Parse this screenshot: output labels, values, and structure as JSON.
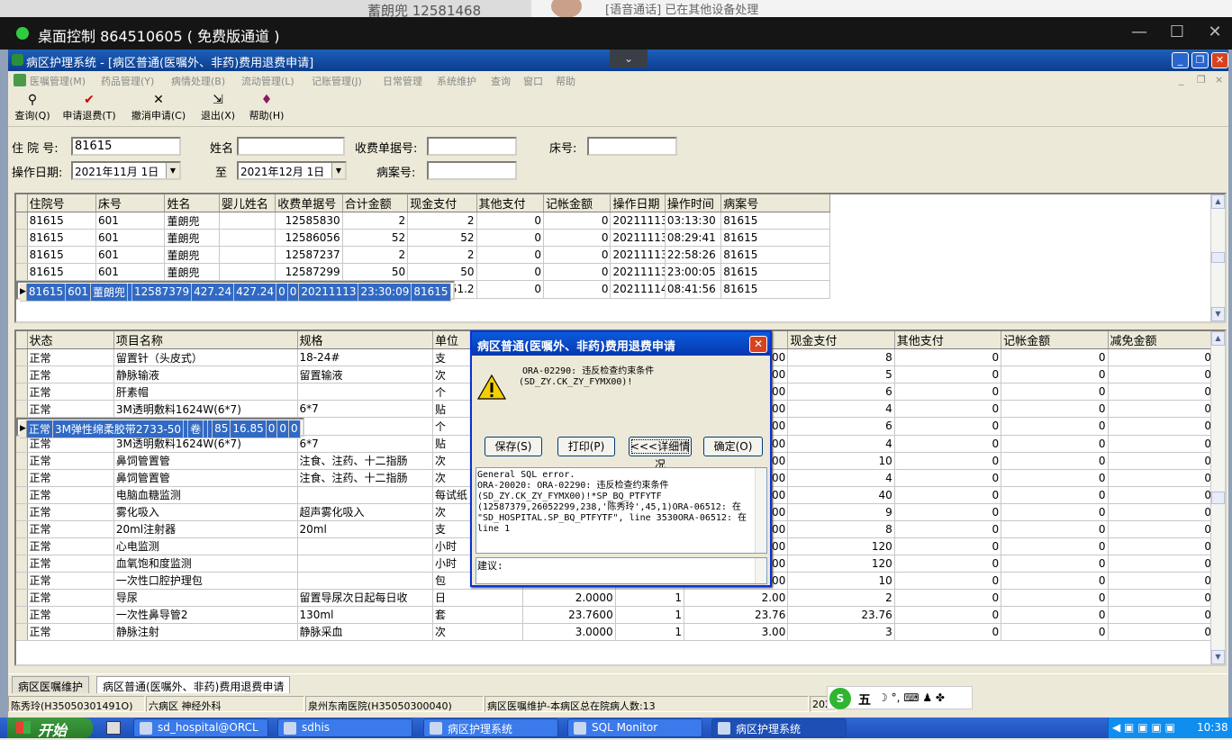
{
  "bg": {
    "notification": "[语音通话] 已在其他设备处理",
    "behind_text": "蓄朗兜     12581468"
  },
  "remote": {
    "title": "桌面控制 864510605 ( 免费版通道 )",
    "min": "—",
    "max": "☐",
    "close": "✕"
  },
  "app": {
    "title": "病区护理系统 - [病区普通(医嘱外、非药)费用退费申请]",
    "dropdown": "⌄",
    "win_min": "_",
    "win_max": "❐",
    "win_close": "✕"
  },
  "menu": [
    "医嘱管理(M)",
    "药品管理(Y)",
    "病情处理(B)",
    "流动管理(L)",
    "记账管理(J)",
    "日常管理",
    "系统维护",
    "查询",
    "窗口",
    "帮助"
  ],
  "mdi_controls": [
    "_",
    "❐",
    "×"
  ],
  "toolbar": [
    {
      "icon": "binoculars-icon",
      "glyph": "⚲",
      "label": "查询(Q)"
    },
    {
      "icon": "check-icon",
      "glyph": "✔",
      "label": "申请退费(T)"
    },
    {
      "icon": "cross-icon",
      "glyph": "✕",
      "label": "撤消申请(C)"
    },
    {
      "icon": "exit-door-icon",
      "glyph": "⇲",
      "label": "退出(X)"
    },
    {
      "icon": "help-book-icon",
      "glyph": "♦",
      "label": "帮助(H)"
    }
  ],
  "form": {
    "zyh_label": "住 院 号:",
    "zyh_value": "81615",
    "name_label": "姓名",
    "name_value": "",
    "receipt_label": "收费单据号:",
    "receipt_value": "",
    "bed_label": "床号:",
    "bed_value": "",
    "date_label": "操作日期:",
    "date_from": "2021年11月 1日",
    "to_label": "至",
    "date_to": "2021年12月 1日",
    "case_label": "病案号:",
    "case_value": ""
  },
  "grid1": {
    "columns": [
      "住院号",
      "床号",
      "姓名",
      "婴儿姓名",
      "收费单据号",
      "合计金额",
      "现金支付",
      "其他支付",
      "记帐金额",
      "操作日期",
      "操作时间",
      "病案号"
    ],
    "rows": [
      [
        "81615",
        "601",
        "董朗兜",
        "",
        "12585830",
        "2",
        "2",
        "0",
        "0",
        "20211113",
        "03:13:30",
        "81615"
      ],
      [
        "81615",
        "601",
        "董朗兜",
        "",
        "12586056",
        "52",
        "52",
        "0",
        "0",
        "20211113",
        "08:29:41",
        "81615"
      ],
      [
        "81615",
        "601",
        "董朗兜",
        "",
        "12587237",
        "2",
        "2",
        "0",
        "0",
        "20211113",
        "22:58:26",
        "81615"
      ],
      [
        "81615",
        "601",
        "董朗兜",
        "",
        "12587299",
        "50",
        "50",
        "0",
        "0",
        "20211113",
        "23:00:05",
        "81615"
      ],
      [
        "81615",
        "601",
        "董朗兜",
        "",
        "12587379",
        "427.24",
        "427.24",
        "0",
        "0",
        "20211113",
        "23:30:09",
        "81615"
      ],
      [
        "81615",
        "601",
        "董朗兜",
        "",
        "12587650",
        "51.2",
        "51.2",
        "0",
        "0",
        "20211114",
        "08:41:56",
        "81615"
      ]
    ],
    "selected": 4
  },
  "grid2": {
    "columns": [
      "状态",
      "项目名称",
      "规格",
      "单位",
      "",
      "",
      "",
      "现金支付",
      "其他支付",
      "记帐金额",
      "减免金额"
    ],
    "rows": [
      [
        "正常",
        "留置针（头皮式）",
        "18-24#",
        "支",
        "",
        "",
        "00",
        "8",
        "0",
        "0",
        "0"
      ],
      [
        "正常",
        "静脉输液",
        "留置输液",
        "次",
        "",
        "",
        "00",
        "5",
        "0",
        "0",
        "0"
      ],
      [
        "正常",
        "肝素帽",
        "",
        "个",
        "",
        "",
        "00",
        "6",
        "0",
        "0",
        "0"
      ],
      [
        "正常",
        "3M透明敷料1624W(6*7)",
        "6*7",
        "贴",
        "",
        "",
        "00",
        "4",
        "0",
        "0",
        "0"
      ],
      [
        "正常",
        "3M弹性绵柔胶带2733-50",
        "",
        "卷",
        "",
        "",
        "85",
        "16.85",
        "0",
        "0",
        "0"
      ],
      [
        "正常",
        "肝素帽",
        "",
        "个",
        "",
        "",
        "00",
        "6",
        "0",
        "0",
        "0"
      ],
      [
        "正常",
        "3M透明敷料1624W(6*7)",
        "6*7",
        "贴",
        "",
        "",
        "00",
        "4",
        "0",
        "0",
        "0"
      ],
      [
        "正常",
        "鼻饲管置管",
        "注食、注药、十二指肠",
        "次",
        "",
        "",
        "00",
        "10",
        "0",
        "0",
        "0"
      ],
      [
        "正常",
        "鼻饲管置管",
        "注食、注药、十二指肠",
        "次",
        "",
        "",
        "00",
        "4",
        "0",
        "0",
        "0"
      ],
      [
        "正常",
        "电脑血糖监测",
        "",
        "每试纸",
        "",
        "",
        "00",
        "40",
        "0",
        "0",
        "0"
      ],
      [
        "正常",
        "雾化吸入",
        "超声雾化吸入",
        "次",
        "",
        "",
        "00",
        "9",
        "0",
        "0",
        "0"
      ],
      [
        "正常",
        "20ml注射器",
        "20ml",
        "支",
        "",
        "",
        "00",
        "8",
        "0",
        "0",
        "0"
      ],
      [
        "正常",
        "心电监测",
        "",
        "小时",
        "",
        "",
        "00",
        "120",
        "0",
        "0",
        "0"
      ],
      [
        "正常",
        "血氧饱和度监测",
        "",
        "小时",
        "",
        "",
        "00",
        "120",
        "0",
        "0",
        "0"
      ],
      [
        "正常",
        "一次性口腔护理包",
        "",
        "包",
        "5.0000",
        "2",
        "10.00",
        "10",
        "0",
        "0",
        "0"
      ],
      [
        "正常",
        "导尿",
        "留置导尿次日起每日收",
        "日",
        "2.0000",
        "1",
        "2.00",
        "2",
        "0",
        "0",
        "0"
      ],
      [
        "正常",
        "一次性鼻导管2",
        "130ml",
        "套",
        "23.7600",
        "1",
        "23.76",
        "23.76",
        "0",
        "0",
        "0"
      ],
      [
        "正常",
        "静脉注射",
        "静脉采血",
        "次",
        "3.0000",
        "1",
        "3.00",
        "3",
        "0",
        "0",
        "0"
      ]
    ],
    "selected": 4
  },
  "dialog": {
    "title": "病区普通(医嘱外、非药)费用退费申请",
    "close": "✕",
    "message_line1": "ORA-02290: 违反检查约束条件",
    "message_line2": "(SD_ZY.CK_ZY_FYMX00)!",
    "buttons": {
      "save": "保存(S)",
      "print": "打印(P)",
      "details": "<<<详细情况",
      "ok": "确定(O)"
    },
    "detail_lines": [
      "General SQL error.",
      "ORA-20020: ORA-02290: 违反检查约束条件",
      "(SD_ZY.CK_ZY_FYMX00)!*SP_BQ_PTFYTF",
      "(12587379,26052299,238,'陈秀玲',45,1)ORA-06512: 在",
      "\"SD_HOSPITAL.SP_BQ_PTFYTF\", line 3530ORA-06512: 在",
      "line 1"
    ],
    "advice_label": "建议:"
  },
  "tabs": [
    "病区医嘱维护",
    "病区普通(医嘱外、非药)费用退费申请"
  ],
  "status": [
    "陈秀玲(H35050301491O)",
    "六病区 神经外科",
    "泉州东南医院(H35050300040)",
    "病区医嘱维护-本病区总在院病人数:13",
    "202"
  ],
  "ime": {
    "logo": "S",
    "label": "五",
    "icons": "☽ °, ⌨ ♟ ✤"
  },
  "taskbar": {
    "start": "开始",
    "items": [
      "sd_hospital@ORCL",
      "sdhis",
      "病区护理系统",
      "SQL Monitor",
      "病区护理系统"
    ],
    "active": 4,
    "clock": "10:38"
  },
  "colors": {
    "title_blue": "#0b3d8f",
    "selection": "#316ac5",
    "taskbar": "#245edb",
    "start_green": "#3c9a3c"
  }
}
